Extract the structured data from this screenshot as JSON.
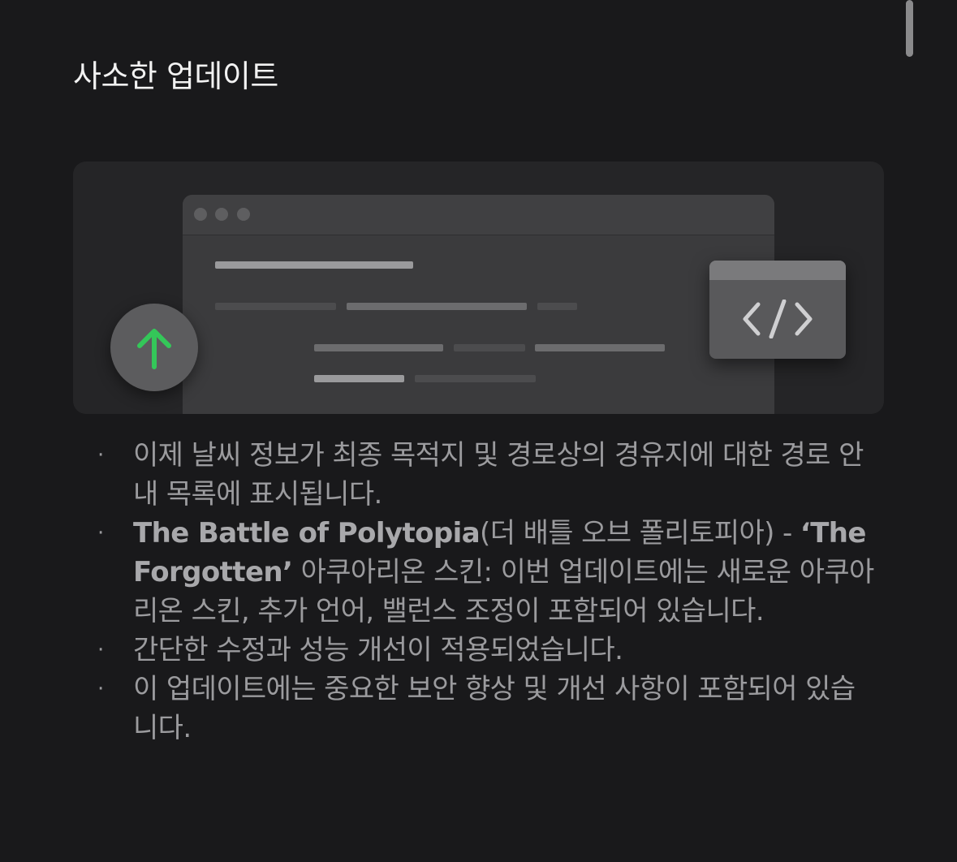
{
  "section": {
    "title": "사소한 업데이트"
  },
  "illustration": {
    "upload_icon": "arrow-up-icon",
    "code_icon": "code-brackets-icon",
    "accent_color": "#34c759"
  },
  "notes": [
    {
      "text": "이제 날씨 정보가 최종 목적지 및 경로상의 경유지에 대한 경로 안내 목록에 표시됩니다."
    },
    {
      "bold": "The Battle of Polytopia",
      "text_a": "(더 배틀 오브 폴리토피아) - ",
      "bold2": "‘The Forgotten’",
      "text_b": " 아쿠아리온 스킨: 이번 업데이트에는 새로운 아쿠아리온 스킨, 추가 언어, 밸런스 조정이 포함되어 있습니다."
    },
    {
      "text": "간단한 수정과 성능 개선이 적용되었습니다."
    },
    {
      "text": "이 업데이트에는 중요한 보안 향상 및 개선 사항이 포함되어 있습니다."
    }
  ],
  "bullet_char": "·"
}
